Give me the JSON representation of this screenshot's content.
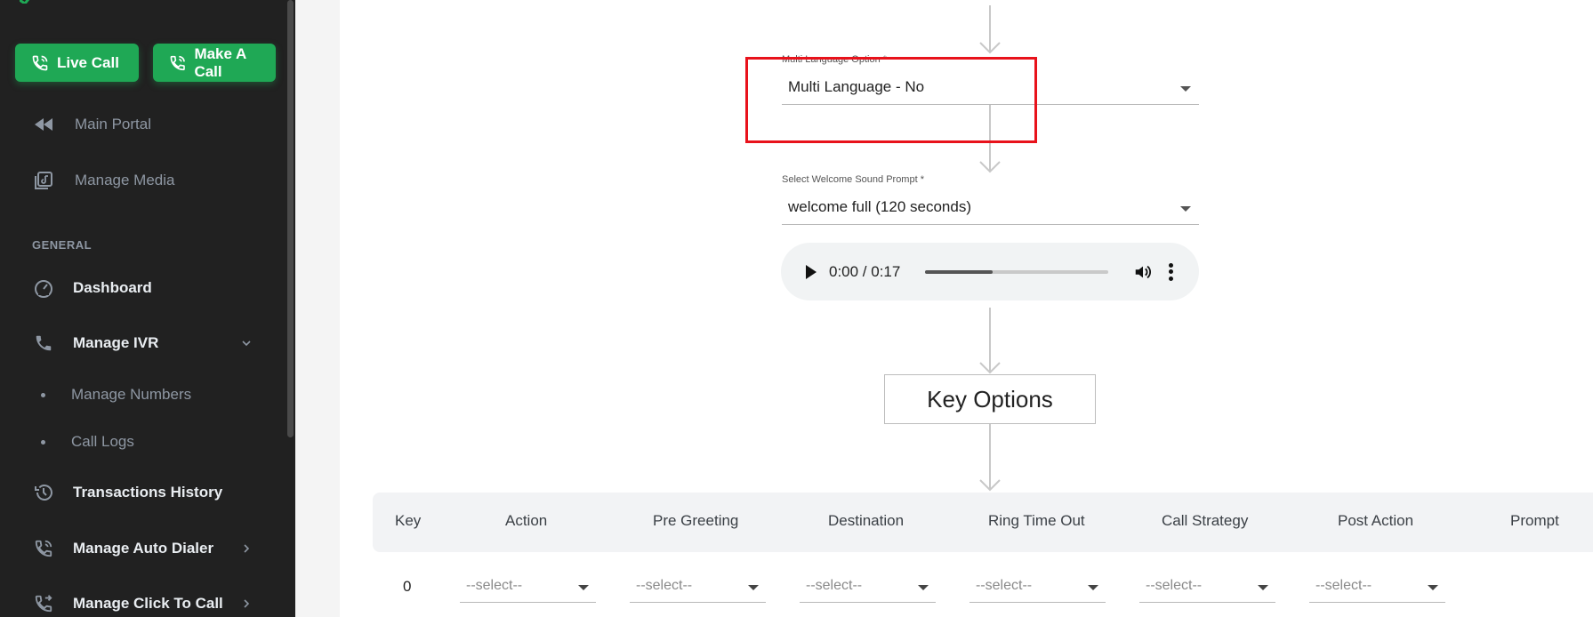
{
  "sidebar": {
    "live_call": "Live Call",
    "make_call": "Make A Call",
    "items": [
      {
        "label": "Main Portal",
        "icon": "rewind-icon"
      },
      {
        "label": "Manage Media",
        "icon": "media-library-icon"
      },
      {
        "label": "Dashboard",
        "icon": "speedometer-icon"
      },
      {
        "label": "Manage IVR",
        "icon": "phone-icon"
      },
      {
        "label": "Transactions History",
        "icon": "history-icon"
      },
      {
        "label": "Manage Auto Dialer",
        "icon": "phone-repeat-icon"
      },
      {
        "label": "Manage Click To Call",
        "icon": "phone-forward-icon"
      }
    ],
    "section_general": "GENERAL",
    "sub_items": [
      "Manage Numbers",
      "Call Logs"
    ],
    "colors": {
      "background": "#212121",
      "accent": "#1fa855"
    }
  },
  "flow": {
    "multi_language": {
      "label": "Multi Language Option *",
      "value": "Multi Language - No"
    },
    "welcome_prompt": {
      "label": "Select Welcome Sound Prompt *",
      "value": "welcome full (120 seconds)"
    },
    "audio": {
      "time": "0:00 / 0:17",
      "progress": 0.37
    },
    "key_options_title": "Key Options"
  },
  "table": {
    "headers": [
      "Key",
      "Action",
      "Pre Greeting",
      "Destination",
      "Ring Time Out",
      "Call Strategy",
      "Post Action",
      "Prompt"
    ],
    "rows": [
      {
        "key": "0",
        "selects": [
          "--select--",
          "--select--",
          "--select--",
          "--select--",
          "--select--",
          "--select--"
        ]
      }
    ]
  },
  "colors": {
    "highlight": "#e8121b"
  }
}
